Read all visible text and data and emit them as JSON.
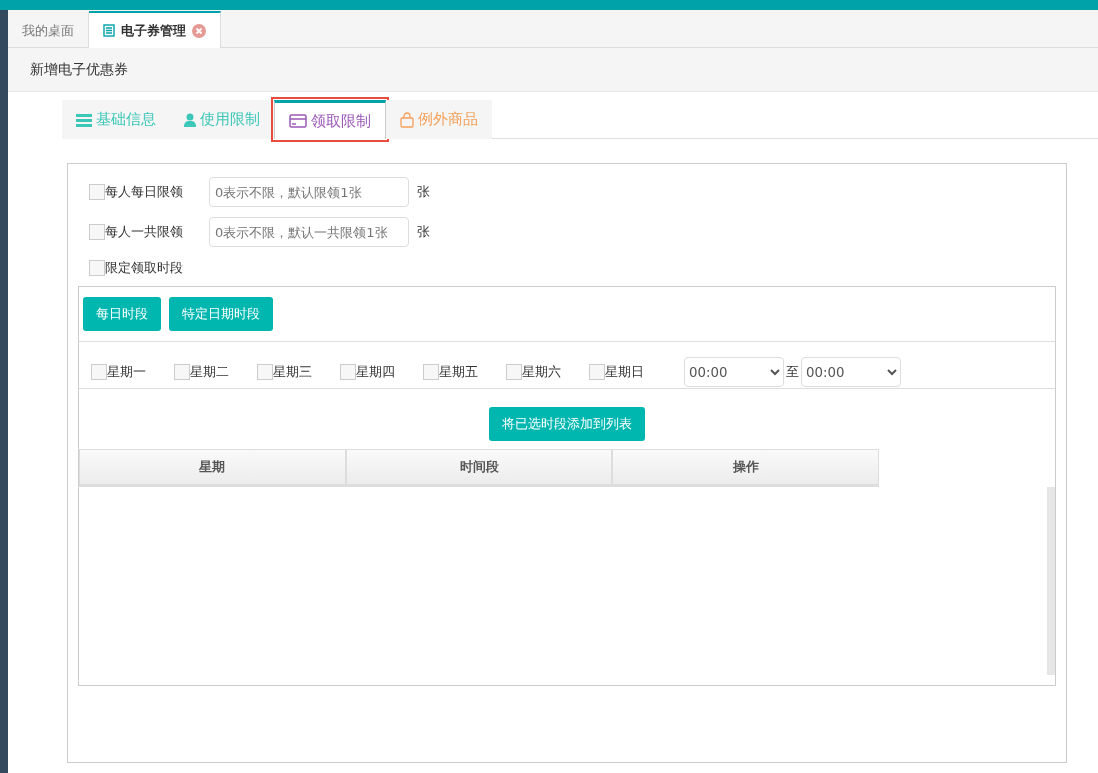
{
  "page_tabs": [
    {
      "label": "我的桌面",
      "selected": false,
      "closable": false
    },
    {
      "label": "电子券管理",
      "selected": true,
      "closable": true
    }
  ],
  "header": {
    "title": "新增电子优惠券"
  },
  "form_tabs": [
    {
      "label": "基础信息",
      "kind": "list",
      "selected": false,
      "color": "#3cc7b8"
    },
    {
      "label": "使用限制",
      "kind": "user",
      "selected": false,
      "color": "#3cc7b8"
    },
    {
      "label": "领取限制",
      "kind": "card",
      "selected": true,
      "color": "#9b59b6"
    },
    {
      "label": "例外商品",
      "kind": "bag",
      "selected": false,
      "color": "#f5a05a"
    }
  ],
  "limits": [
    {
      "label": "每人每日限领",
      "checked": false,
      "placeholder": "0表示不限，默认限领1张",
      "unit": "张"
    },
    {
      "label": "每人一共限领",
      "checked": false,
      "placeholder": "0表示不限，默认一共限领1张",
      "unit": "张"
    }
  ],
  "time_limit": {
    "label": "限定领取时段",
    "checked": false
  },
  "period_buttons": [
    "每日时段",
    "特定日期时段"
  ],
  "weekdays": [
    {
      "label": "星期一",
      "checked": false
    },
    {
      "label": "星期二",
      "checked": false
    },
    {
      "label": "星期三",
      "checked": false
    },
    {
      "label": "星期四",
      "checked": false
    },
    {
      "label": "星期五",
      "checked": false
    },
    {
      "label": "星期六",
      "checked": false
    },
    {
      "label": "星期日",
      "checked": false
    }
  ],
  "time_from": "00:00",
  "time_sep": "至",
  "time_to": "00:00",
  "add_button": "将已选时段添加到列表",
  "table": {
    "columns": [
      "星期",
      "时间段",
      "操作"
    ]
  }
}
